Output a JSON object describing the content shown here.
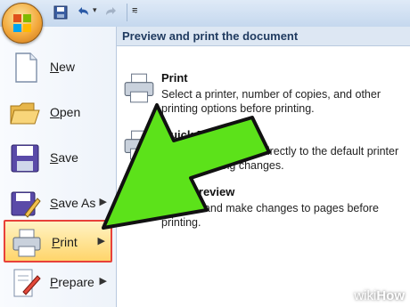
{
  "quick_access": {
    "customize_glyph": "⩳"
  },
  "menu": {
    "items": [
      {
        "label": "New",
        "has_arrow": false
      },
      {
        "label": "Open",
        "has_arrow": false
      },
      {
        "label": "Save",
        "has_arrow": false
      },
      {
        "label": "Save As",
        "has_arrow": true
      },
      {
        "label": "Print",
        "has_arrow": true,
        "selected": true
      },
      {
        "label": "Prepare",
        "has_arrow": true
      }
    ],
    "arrow_glyph": "▶"
  },
  "submenu": {
    "heading": "Preview and print the document",
    "options": [
      {
        "title": "Print",
        "description": "Select a printer, number of copies, and other printing options before printing."
      },
      {
        "title": "Quick Print",
        "description": "Send the document directly to the default printer without making changes."
      },
      {
        "title": "Print Preview",
        "description": "Preview and make changes to pages before printing."
      }
    ]
  },
  "watermark": {
    "brand_a": "wiki",
    "brand_b": "How"
  },
  "colors": {
    "selection_border": "#e8413a",
    "arrow_fill": "#5ce21a",
    "arrow_stroke": "#111111"
  }
}
